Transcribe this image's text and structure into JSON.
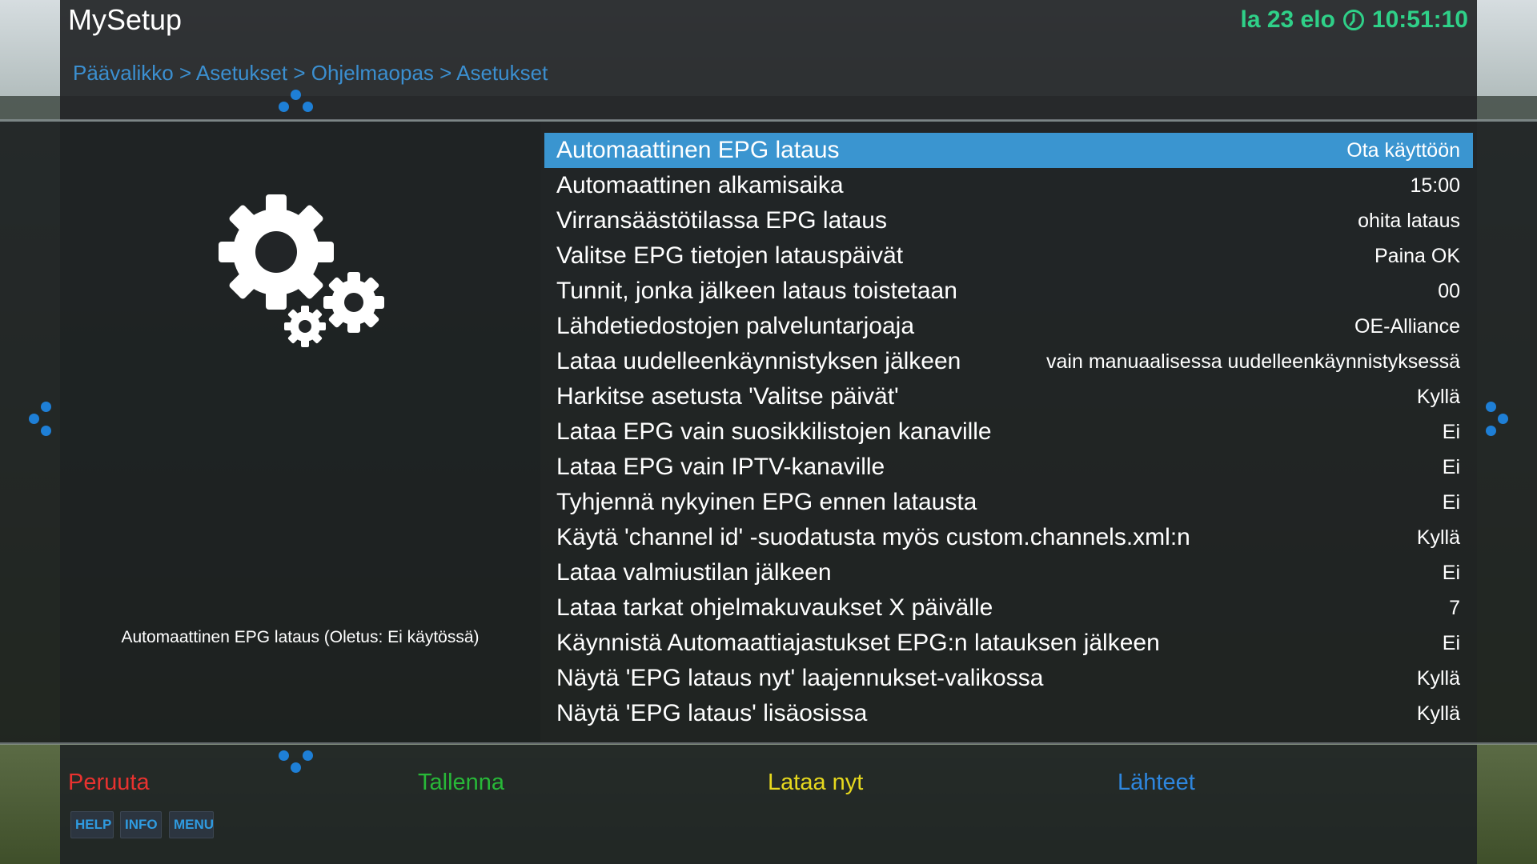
{
  "header": {
    "title": "MySetup",
    "clock": "la 23 elo",
    "time": "10:51:10",
    "breadcrumb": "Päävalikko > Asetukset > Ohjelmaopas > Asetukset"
  },
  "help_text": "Automaattinen EPG lataus   (Oletus: Ei käytössä)",
  "settings": [
    {
      "label": "Automaattinen EPG lataus",
      "value": "Ota käyttöön",
      "selected": true
    },
    {
      "label": "Automaattinen alkamisaika",
      "value": "15:00"
    },
    {
      "label": "Virransäästötilassa EPG lataus",
      "value": "ohita lataus"
    },
    {
      "label": "Valitse EPG tietojen latauspäivät",
      "value": "Paina OK"
    },
    {
      "label": "Tunnit, jonka jälkeen lataus toistetaan",
      "value": "00"
    },
    {
      "label": "Lähdetiedostojen palveluntarjoaja",
      "value": "OE-Alliance"
    },
    {
      "label": "Lataa uudelleenkäynnistyksen jälkeen",
      "value": "vain manuaalisessa uudelleenkäynnistyksessä"
    },
    {
      "label": "Harkitse asetusta 'Valitse päivät'",
      "value": "Kyllä"
    },
    {
      "label": "Lataa EPG vain suosikkilistojen kanaville",
      "value": "Ei"
    },
    {
      "label": "Lataa EPG vain IPTV-kanaville",
      "value": "Ei"
    },
    {
      "label": "Tyhjennä nykyinen EPG ennen latausta",
      "value": "Ei"
    },
    {
      "label": "Käytä 'channel id' -suodatusta myös custom.channels.xml:n",
      "value": "Kyllä"
    },
    {
      "label": "Lataa valmiustilan jälkeen",
      "value": "Ei"
    },
    {
      "label": "Lataa tarkat ohjelmakuvaukset X päivälle",
      "value": "7"
    },
    {
      "label": "Käynnistä Automaattiajastukset EPG:n latauksen jälkeen",
      "value": "Ei"
    },
    {
      "label": "Näytä 'EPG lataus nyt' laajennukset-valikossa",
      "value": "Kyllä"
    },
    {
      "label": "Näytä 'EPG lataus' lisäosissa",
      "value": "Kyllä"
    }
  ],
  "footer": {
    "red": "Peruuta",
    "green": "Tallenna",
    "yellow": "Lataa nyt",
    "blue": "Lähteet",
    "help": "HELP",
    "info": "INFO",
    "menu": "MENU"
  },
  "colors": {
    "red": "#e8322f",
    "green": "#28b838",
    "yellow": "#e6d81e",
    "blue": "#2e86de",
    "clock": "#2fd088",
    "selection": "#3a95d0"
  }
}
